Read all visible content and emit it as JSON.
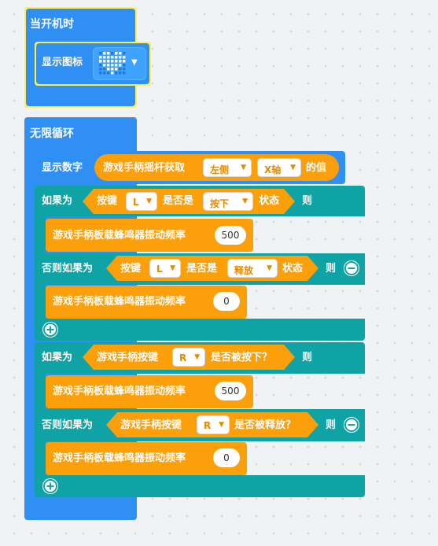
{
  "on_start": {
    "hat_label": "当开机时",
    "show_icon_label": "显示图标",
    "icon_name": "heart-icon"
  },
  "forever": {
    "label": "无限循环",
    "show_number_label": "显示数字",
    "joystick": {
      "label": "游戏手柄摇杆获取",
      "side_value": "左侧",
      "axis_value": "X轴",
      "suffix": "的值"
    },
    "if1": {
      "if_label": "如果为",
      "then_label": "则",
      "cond": {
        "key_label": "按键",
        "key_value": "L",
        "is_label": "是否是",
        "state_value": "按下",
        "state_label": "状态"
      },
      "stmt": {
        "label": "游戏手柄板载蜂鸣器振动频率",
        "value": "500"
      },
      "elseif_label": "否则如果为",
      "elseif_then_label": "则",
      "cond2": {
        "key_label": "按键",
        "key_value": "L",
        "is_label": "是否是",
        "state_value": "释放",
        "state_label": "状态"
      },
      "stmt2": {
        "label": "游戏手柄板载蜂鸣器振动频率",
        "value": "0"
      }
    },
    "if2": {
      "if_label": "如果为",
      "then_label": "则",
      "cond": {
        "label": "游戏手柄按键",
        "key_value": "R",
        "suffix": "是否被按下？"
      },
      "stmt": {
        "label": "游戏手柄板载蜂鸣器振动频率",
        "value": "500"
      },
      "elseif_label": "否则如果为",
      "elseif_then_label": "则",
      "cond2": {
        "label": "游戏手柄按键",
        "key_value": "R",
        "suffix": "是否被释放？"
      },
      "stmt2": {
        "label": "游戏手柄板载蜂鸣器振动频率",
        "value": "0"
      }
    }
  },
  "colors": {
    "event": "#fff04a",
    "basic": "#2f8ff2",
    "logic": "#10a3a6",
    "gamepad": "#fb9f0b",
    "heart_led": "#ffffff"
  }
}
